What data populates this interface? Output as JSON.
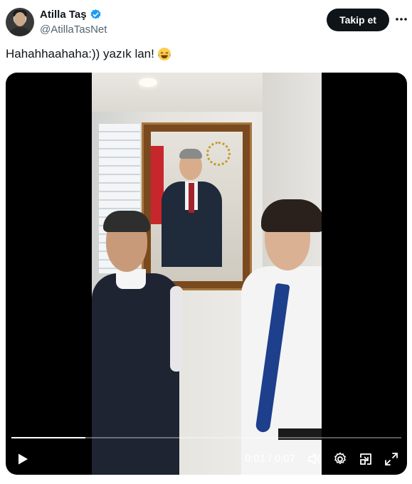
{
  "author": {
    "name": "Atilla Taş",
    "handle": "@AtillaTasNet",
    "verified_color": "#1d9bf0"
  },
  "follow_button": {
    "label": "Takip et"
  },
  "tweet": {
    "text": "Hahahhaahaha:)) yazık lan!",
    "emoji": "face-with-tears-of-joy"
  },
  "video": {
    "current_time": "0:01",
    "separator": "/",
    "duration": "0:07",
    "progress_fraction": 0.19
  },
  "icons": {
    "more": "more-horizontal-icon",
    "play": "play-icon",
    "volume": "volume-icon",
    "settings": "settings-icon",
    "pip": "picture-in-picture-icon",
    "fullscreen": "fullscreen-icon"
  }
}
